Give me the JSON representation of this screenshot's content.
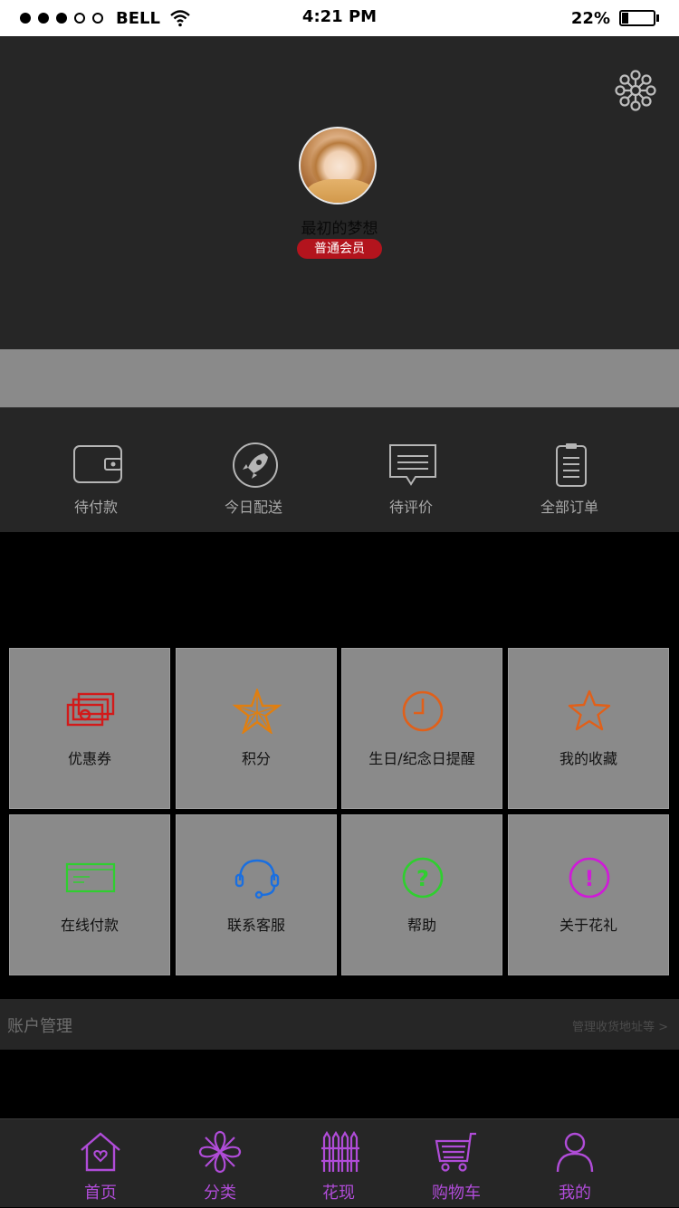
{
  "status_bar": {
    "carrier": "BELL",
    "time": "4:21 PM",
    "battery_percent": "22%",
    "battery_level": 0.22
  },
  "profile": {
    "nickname": "最初的梦想",
    "member_level": "普通会员"
  },
  "orders": [
    {
      "label": "待付款",
      "icon": "wallet-icon"
    },
    {
      "label": "今日配送",
      "icon": "rocket-icon"
    },
    {
      "label": "待评价",
      "icon": "comment-icon"
    },
    {
      "label": "全部订单",
      "icon": "clipboard-icon"
    }
  ],
  "grid": [
    {
      "label": "优惠券",
      "icon": "coupon-icon",
      "color": "#d21a1a"
    },
    {
      "label": "积分",
      "icon": "points-star-icon",
      "color": "#e07f10"
    },
    {
      "label": "生日/纪念日提醒",
      "icon": "clock-icon",
      "color": "#e0601a"
    },
    {
      "label": "我的收藏",
      "icon": "favorite-star-icon",
      "color": "#e0601a"
    },
    {
      "label": "在线付款",
      "icon": "card-icon",
      "color": "#2fcf2f"
    },
    {
      "label": "联系客服",
      "icon": "headset-icon",
      "color": "#1a6fe0"
    },
    {
      "label": "帮助",
      "icon": "help-icon",
      "color": "#2fcf2f"
    },
    {
      "label": "关于花礼",
      "icon": "info-icon",
      "color": "#d01ad8"
    }
  ],
  "account": {
    "title": "账户管理",
    "link": "管理收货地址等 >"
  },
  "tabs": [
    {
      "label": "首页",
      "icon": "home-icon"
    },
    {
      "label": "分类",
      "icon": "flower-icon"
    },
    {
      "label": "花现",
      "icon": "fence-icon"
    },
    {
      "label": "购物车",
      "icon": "cart-icon"
    },
    {
      "label": "我的",
      "icon": "user-icon"
    }
  ],
  "colors": {
    "accent": "#b04cd8",
    "badge": "#b3141d"
  }
}
